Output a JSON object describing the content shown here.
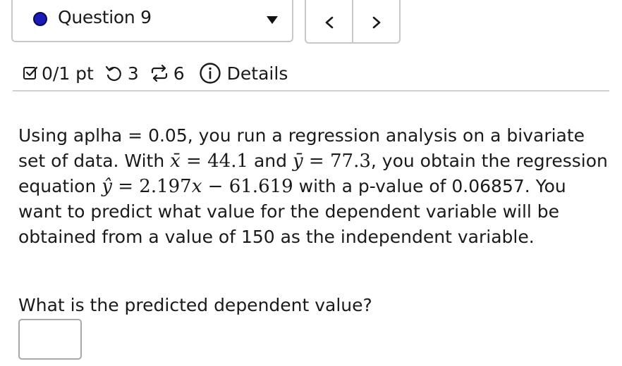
{
  "header": {
    "question_label": "Question 9",
    "status_color": "#1a1ab8",
    "prev_label": "<",
    "next_label": ">"
  },
  "meta": {
    "score": "0/1 pt",
    "retries": "3",
    "submissions": "6",
    "details_label": "Details",
    "icons": [
      "checkbox-icon",
      "retry-icon",
      "refresh-icon",
      "info-icon"
    ]
  },
  "question": {
    "p1_a": "Using aplha = 0.05, you run a regression analysis on a bivariate set of data. With ",
    "xbar_sym": "x̄",
    "xbar_val": "44.1",
    "and": " and ",
    "ybar_sym": "ȳ",
    "ybar_val": "77.3",
    "p1_b": ", you obtain the regression equation ",
    "yhat_sym": "ŷ",
    "eq_coef": "2.197",
    "eq_var": "x",
    "eq_minus": "61.619",
    "p1_c": " with a p-value of 0.06857. You want to predict what value for the dependent variable will be obtained from a value of 150 as the independent variable.",
    "prompt": "What is the predicted dependent value?",
    "answer_value": ""
  }
}
